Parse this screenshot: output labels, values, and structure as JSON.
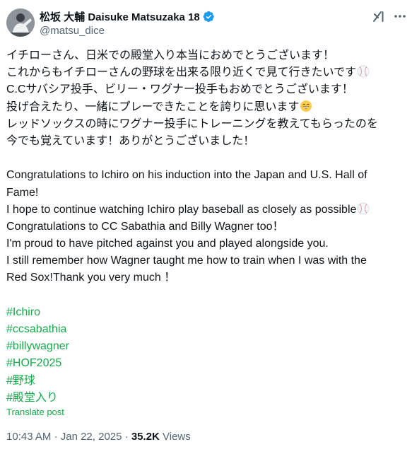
{
  "author": {
    "display_name": "松坂 大輔  Daisuke Matsuzaka 18",
    "handle": "@matsu_dice",
    "verified_color": "#1d9bf0"
  },
  "header_icons": {
    "grok": "grok-icon",
    "more": "more-icon"
  },
  "tweet": {
    "lines_ja": [
      "イチローさん、日米での殿堂入り本当におめでとうございます！",
      "これからもイチローさんの野球を出来る限り近くで見て行きたいです",
      "C.Cサバシア投手、ビリー・ワグナー投手もおめでとうございます！",
      "投げ合えたり、一緒にプレーできたことを誇りに思います",
      "レッドソックスの時にワグナー投手にトレーニングを教えてもらったのを",
      "今でも覚えています！ありがとうございました！"
    ],
    "lines_en": [
      "Congratulations to Ichiro on his induction into the Japan and U.S. Hall of",
      "Fame!",
      "I hope to continue watching Ichiro play baseball as closely as possible",
      "Congratulations to CC Sabathia and Billy Wagner too！",
      "I'm proud to have pitched against you and played alongside you.",
      "I still remember how Wagner taught me how to train when I was with the",
      "Red Sox!Thank you very much ！"
    ],
    "emojis": {
      "baseball": "baseball-emoji",
      "smile": "grinning-smiling-eyes-emoji"
    },
    "hashtags": [
      "#Ichiro",
      "#ccsabathia",
      "#billywagner",
      "#HOF2025",
      "#野球",
      "#殿堂入り"
    ]
  },
  "translate_label": "Translate post",
  "meta": {
    "time": "10:43 AM",
    "separator": " · ",
    "date": "Jan 22, 2025",
    "views_count": "35.2K",
    "views_label": " Views"
  },
  "colors": {
    "text": "#0f1419",
    "secondary": "#536471",
    "link": "#17a94a",
    "verified": "#1d9bf0"
  }
}
